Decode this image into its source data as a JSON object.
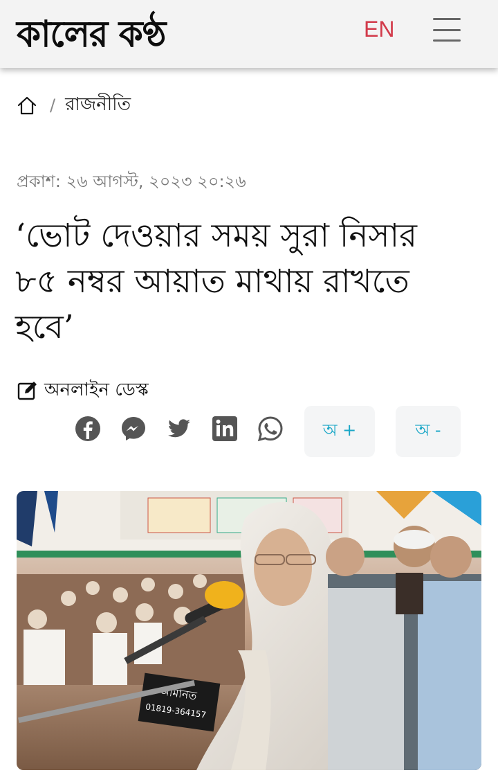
{
  "header": {
    "logo_text": "কালের কণ্ঠ",
    "lang_label": "EN",
    "menu_icon": "hamburger-menu-icon",
    "accent_color": "#d23a4a"
  },
  "breadcrumb": {
    "home_icon": "home-icon",
    "separator": "/",
    "section": "রাজনীতি"
  },
  "article": {
    "published": "প্রকাশ: ২৬ আগস্ট, ২০২৩ ২০:২৬",
    "headline": "‘ভোট দেওয়ার সময় সুরা নিসার ৮৫ নম্বর আয়াত মাথায় রাখতে হবে’",
    "author": "অনলাইন ডেস্ক",
    "author_icon": "edit-icon"
  },
  "share": {
    "icons": [
      "facebook-icon",
      "messenger-icon",
      "twitter-icon",
      "linkedin-icon",
      "whatsapp-icon"
    ],
    "font_increase": "অ +",
    "font_decrease": "অ -"
  },
  "photo": {
    "sign_text": "আমানত",
    "sign_number": "01819-364157"
  }
}
